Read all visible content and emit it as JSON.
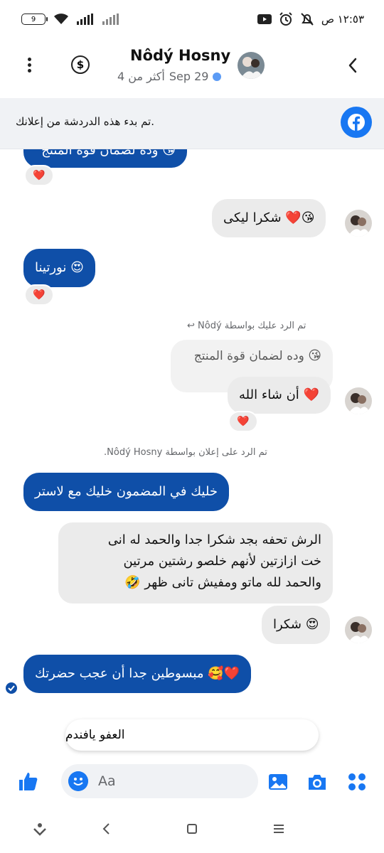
{
  "status_bar": {
    "battery": "9",
    "time": "١٢:٥٣ ص"
  },
  "header": {
    "contact_name": "Nôdý Hosny",
    "last_seen": "Sep 29",
    "more_than": "أكثر من 4"
  },
  "banner": {
    "text": ".تم بدء هذه الدردشة من إعلانك"
  },
  "messages": {
    "m1_partial": "وده لضمان قوة المنتج",
    "m2": "شكرا ليكى",
    "m3": "نورتينا",
    "reply_note_1": "تم الرد عليك بواسطة Nôdý",
    "quoted": "وده لضمان قوة المنتج",
    "m4": "أن شاء الله",
    "reply_note_2": "تم الرد على إعلان بواسطة Nôdý Hosny.",
    "m5": "خليك في المضمون خليك مع لاستر",
    "m6_line1": "الرش تحفه بجد شكرا جدا والحمد له انى",
    "m6_line2": "خت ازازتين لأنهم خلصو رشتين مرتين",
    "m6_line3": "والحمد لله ماتو ومفيش تانى ظهر",
    "m7": "شكرا",
    "m8": "مبسوطين جدا أن عجب حضرتك"
  },
  "emojis": {
    "kiss": "😘",
    "heart": "❤️",
    "heart_eyes": "😍",
    "rofl": "🤣",
    "smiling_hearts": "🥰"
  },
  "typing_suggestion": "العفو يافندم",
  "composer": {
    "placeholder": "Aa"
  },
  "colors": {
    "sent_bubble": "#0f4fa8",
    "recv_bubble": "#ebebeb",
    "accent": "#1877f2"
  }
}
